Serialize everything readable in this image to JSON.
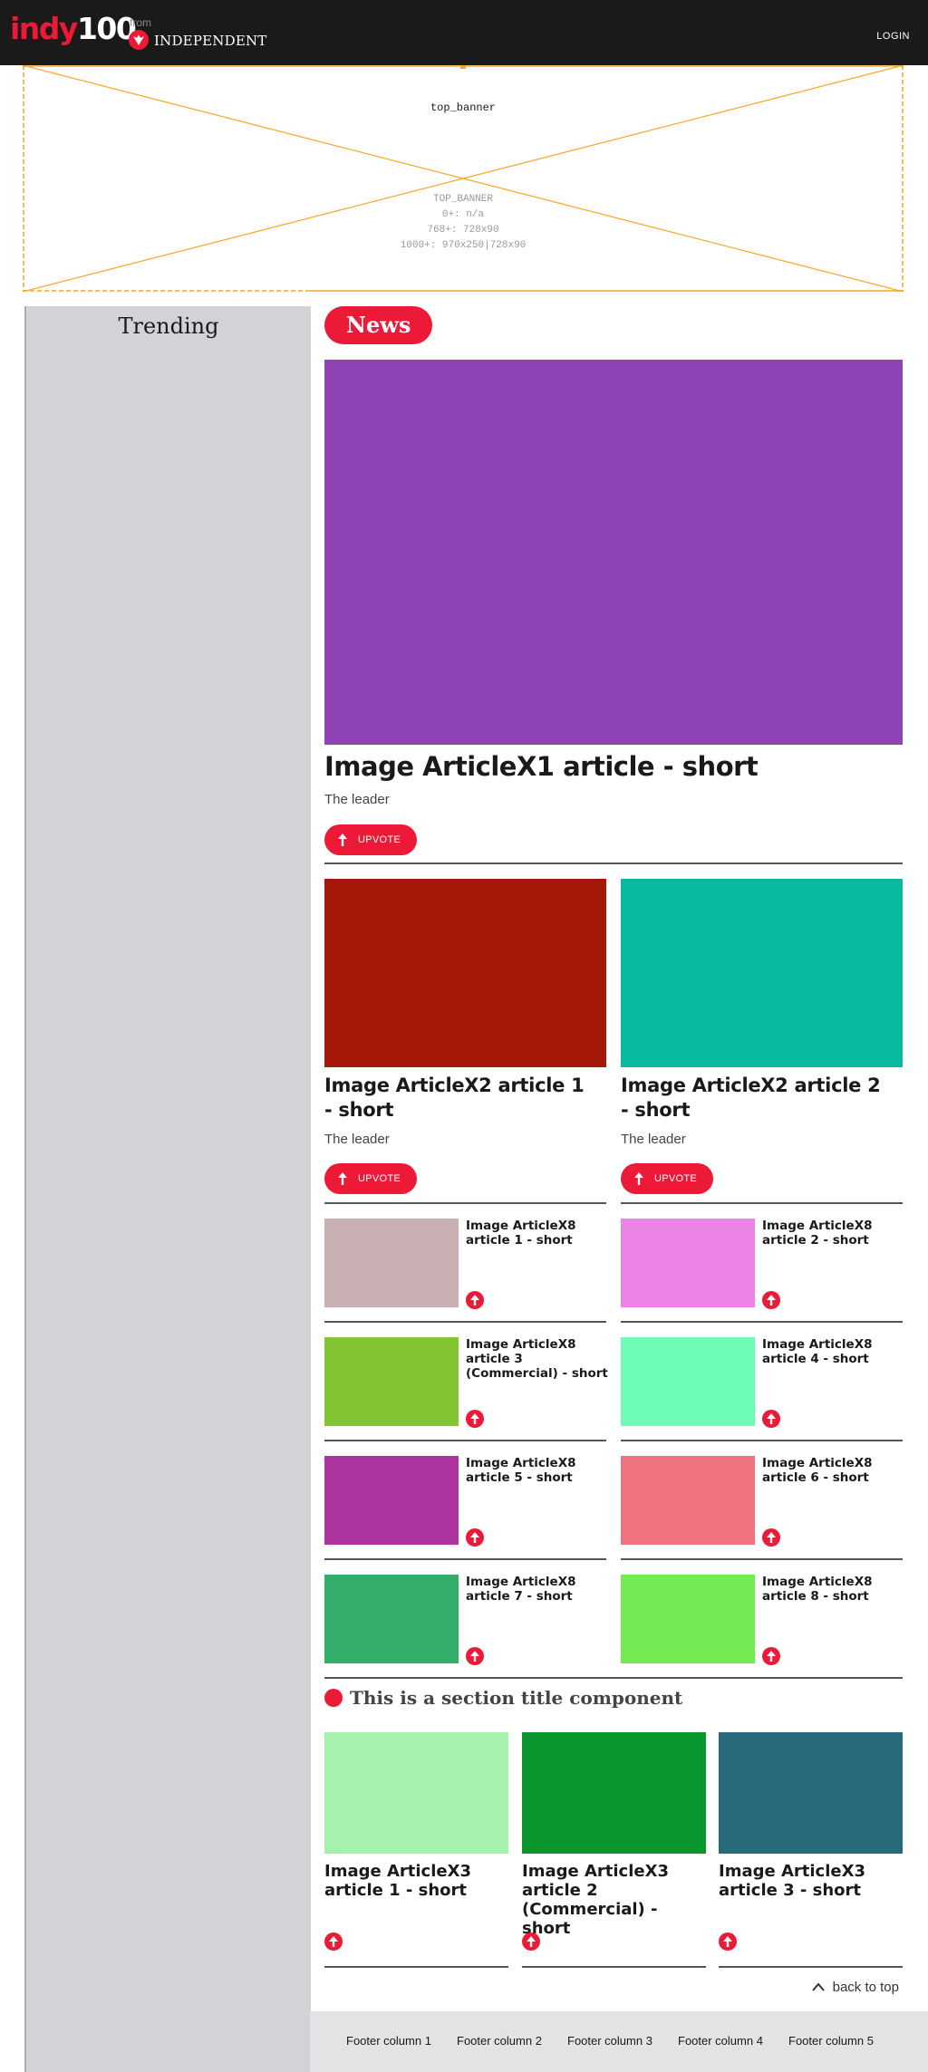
{
  "header": {
    "logo_text": "indy",
    "logo_number": "100",
    "from_label": "from",
    "partner_name": "INDEPENDENT",
    "login_label": "LOGIN"
  },
  "banner": {
    "name": "top_banner",
    "info": [
      "TOP_BANNER",
      "0+: n/a",
      "768+: 728x90",
      "1000+: 970x250|728x90"
    ]
  },
  "sidebar": {
    "title": "Trending"
  },
  "section_pill": "News",
  "lead_article": {
    "title": "Image ArticleX1 article - short",
    "leader": "The leader",
    "upvote_label": "UPVOTE",
    "image_color": "#8e44b5"
  },
  "x2_articles": [
    {
      "title": "Image ArticleX2 article 1 - short",
      "leader": "The leader",
      "upvote_label": "UPVOTE",
      "image_color": "#a51708"
    },
    {
      "title": "Image ArticleX2 article 2 - short",
      "leader": "The leader",
      "upvote_label": "UPVOTE",
      "image_color": "#07bba1"
    }
  ],
  "x8_articles": [
    {
      "title": "Image ArticleX8 article 1 - short",
      "image_color": "#c9b1b3"
    },
    {
      "title": "Image ArticleX8 article 2 - short",
      "image_color": "#ec84e8"
    },
    {
      "title": "Image ArticleX8 article 3 (Commercial) - short",
      "image_color": "#83c434"
    },
    {
      "title": "Image ArticleX8 article 4 - short",
      "image_color": "#6dfbb5"
    },
    {
      "title": "Image ArticleX8 article 5 - short",
      "image_color": "#ad34a0"
    },
    {
      "title": "Image ArticleX8 article 6 - short",
      "image_color": "#ef727f"
    },
    {
      "title": "Image ArticleX8 article 7 - short",
      "image_color": "#33ad6a"
    },
    {
      "title": "Image ArticleX8 article 8 - short",
      "image_color": "#74e951"
    }
  ],
  "section_title": "This is a section title component",
  "x3_articles": [
    {
      "title": "Image ArticleX3 article 1 - short",
      "image_color": "#a6f1ae"
    },
    {
      "title": "Image ArticleX3 article 2 (Commercial) - short",
      "image_color": "#0a962f"
    },
    {
      "title": "Image ArticleX3 article 3 - short",
      "image_color": "#266a7b"
    }
  ],
  "back_to_top": "back to top",
  "footer": {
    "columns": [
      "Footer column 1",
      "Footer column 2",
      "Footer column 3",
      "Footer column 4",
      "Footer column 5"
    ]
  },
  "colors": {
    "brand_red": "#ec1a37",
    "header_bg": "#1a1a1a",
    "sidebar_bg": "#d1d3d7",
    "banner_outline": "#f5a623"
  }
}
